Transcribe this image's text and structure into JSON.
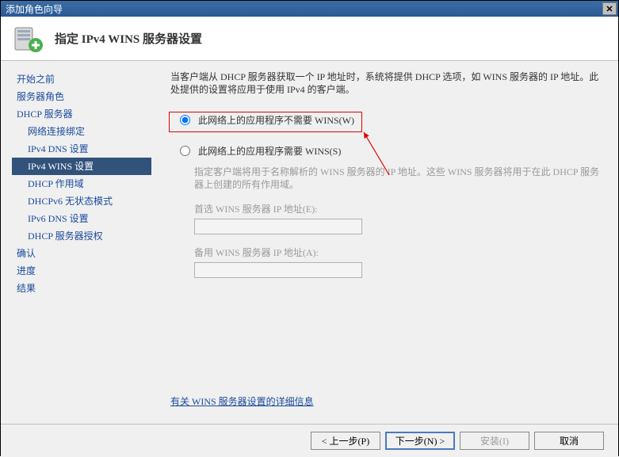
{
  "titlebar": {
    "text": "添加角色向导"
  },
  "header": {
    "title": "指定 IPv4 WINS 服务器设置"
  },
  "sidebar": {
    "items": [
      {
        "label": "开始之前",
        "indent": false
      },
      {
        "label": "服务器角色",
        "indent": false
      },
      {
        "label": "DHCP 服务器",
        "indent": false
      },
      {
        "label": "网络连接绑定",
        "indent": true
      },
      {
        "label": "IPv4 DNS 设置",
        "indent": true
      },
      {
        "label": "IPv4 WINS 设置",
        "indent": true,
        "selected": true
      },
      {
        "label": "DHCP 作用域",
        "indent": true
      },
      {
        "label": "DHCPv6 无状态模式",
        "indent": true
      },
      {
        "label": "IPv6 DNS 设置",
        "indent": true
      },
      {
        "label": "DHCP 服务器授权",
        "indent": true
      },
      {
        "label": "确认",
        "indent": false
      },
      {
        "label": "进度",
        "indent": false
      },
      {
        "label": "结果",
        "indent": false
      }
    ]
  },
  "content": {
    "description": "当客户端从 DHCP 服务器获取一个 IP 地址时，系统将提供 DHCP 选项，如 WINS 服务器的 IP 地址。此处提供的设置将应用于使用 IPv4 的客户端。",
    "radio1_label": "此网络上的应用程序不需要 WINS(W)",
    "radio2_label": "此网络上的应用程序需要 WINS(S)",
    "sub_desc": "指定客户端将用于名称解析的 WINS 服务器的 IP 地址。这些 WINS 服务器将用于在此 DHCP 服务器上创建的所有作用域。",
    "primary_label": "首选 WINS 服务器 IP 地址(E):",
    "primary_value": "",
    "alt_label": "备用 WINS 服务器 IP 地址(A):",
    "alt_value": "",
    "link_text": "有关 WINS 服务器设置的详细信息"
  },
  "footer": {
    "prev": "< 上一步(P)",
    "next": "下一步(N) >",
    "install": "安装(I)",
    "cancel": "取消"
  }
}
